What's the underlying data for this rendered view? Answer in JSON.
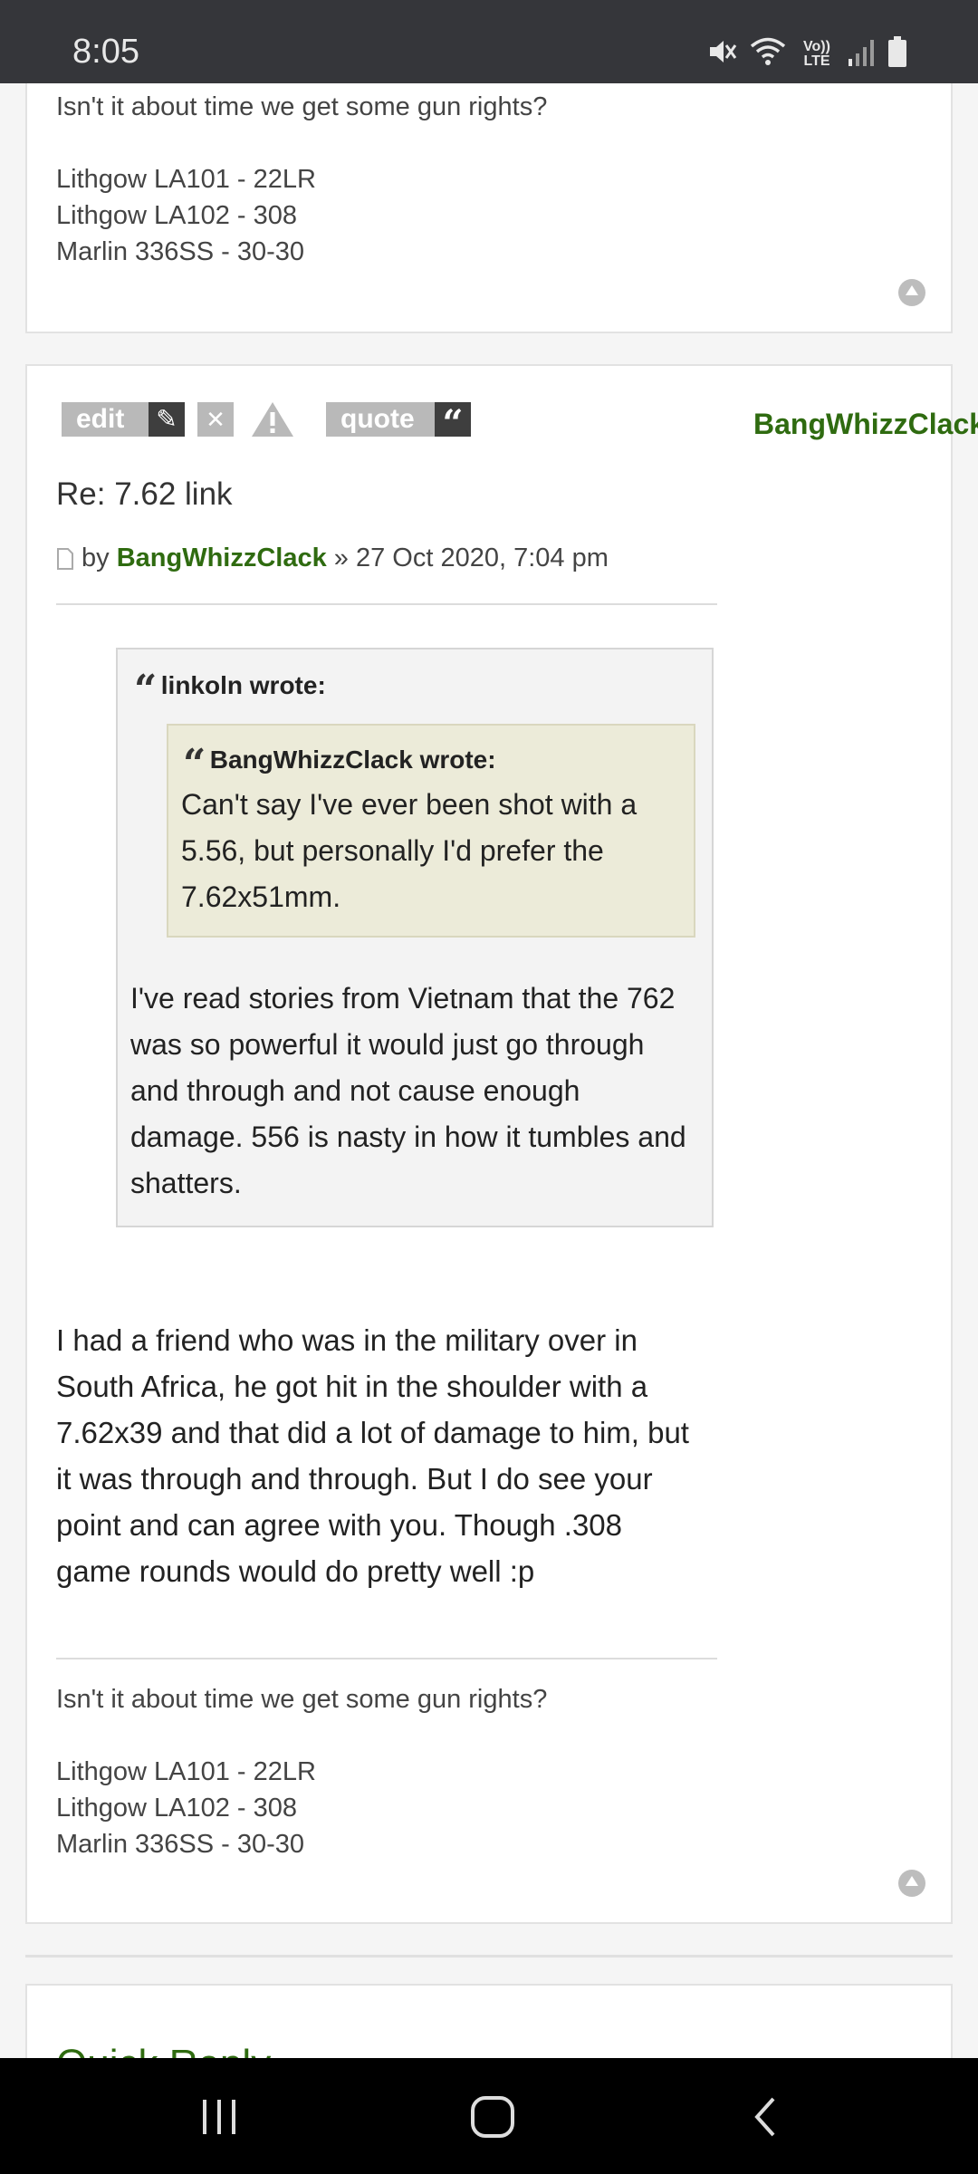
{
  "status_bar": {
    "time": "8:05",
    "network_label": "Vo)) LTE",
    "icons": [
      "mute-icon",
      "wifi-icon",
      "volte-icon",
      "signal-icon",
      "battery-icon"
    ]
  },
  "top_post": {
    "signature": {
      "line1": "Isn't it about time we get some gun rights?",
      "line2": "Lithgow LA101 - 22LR",
      "line3": "Lithgow LA102 - 308",
      "line4": "Marlin 336SS - 30-30"
    }
  },
  "post": {
    "buttons": {
      "edit": "edit",
      "quote": "quote"
    },
    "author_side": "BangWhizzClack",
    "title": "Re: 7.62 link",
    "meta": {
      "by": "by",
      "author": "BangWhizzClack",
      "date": "» 27 Oct 2020, 7:04 pm"
    },
    "quote": {
      "cite": "linkoln wrote:",
      "nested": {
        "cite": "BangWhizzClack wrote:",
        "line1": "Can't say I've ever been shot with a",
        "line2": "5.56, but personally I'd prefer the",
        "line3": "7.62x51mm."
      },
      "line1": "I've read stories from Vietnam that the 762",
      "line2": "was so powerful it would just go through",
      "line3": "and through and not cause enough",
      "line4": "damage. 556 is nasty in how it tumbles and",
      "line5": "shatters."
    },
    "body": {
      "line1": "I had a friend who was in the military over in",
      "line2": "South Africa, he got hit in the shoulder with a",
      "line3": "7.62x39 and that did a lot of damage to him, but",
      "line4": "it was through and through. But I do see your",
      "line5": "point and can agree with you. Though .308",
      "line6": "game rounds would do pretty well :p"
    },
    "signature": {
      "line1": "Isn't it about time we get some gun rights?",
      "line2": "Lithgow LA101 - 22LR",
      "line3": "Lithgow LA102 - 308",
      "line4": "Marlin 336SS - 30-30"
    }
  },
  "quick_reply": {
    "title": "Quick Reply"
  },
  "colors": {
    "accent_green": "#2f6b10",
    "status_bar": "#35363a",
    "nav_bar": "#000000"
  }
}
